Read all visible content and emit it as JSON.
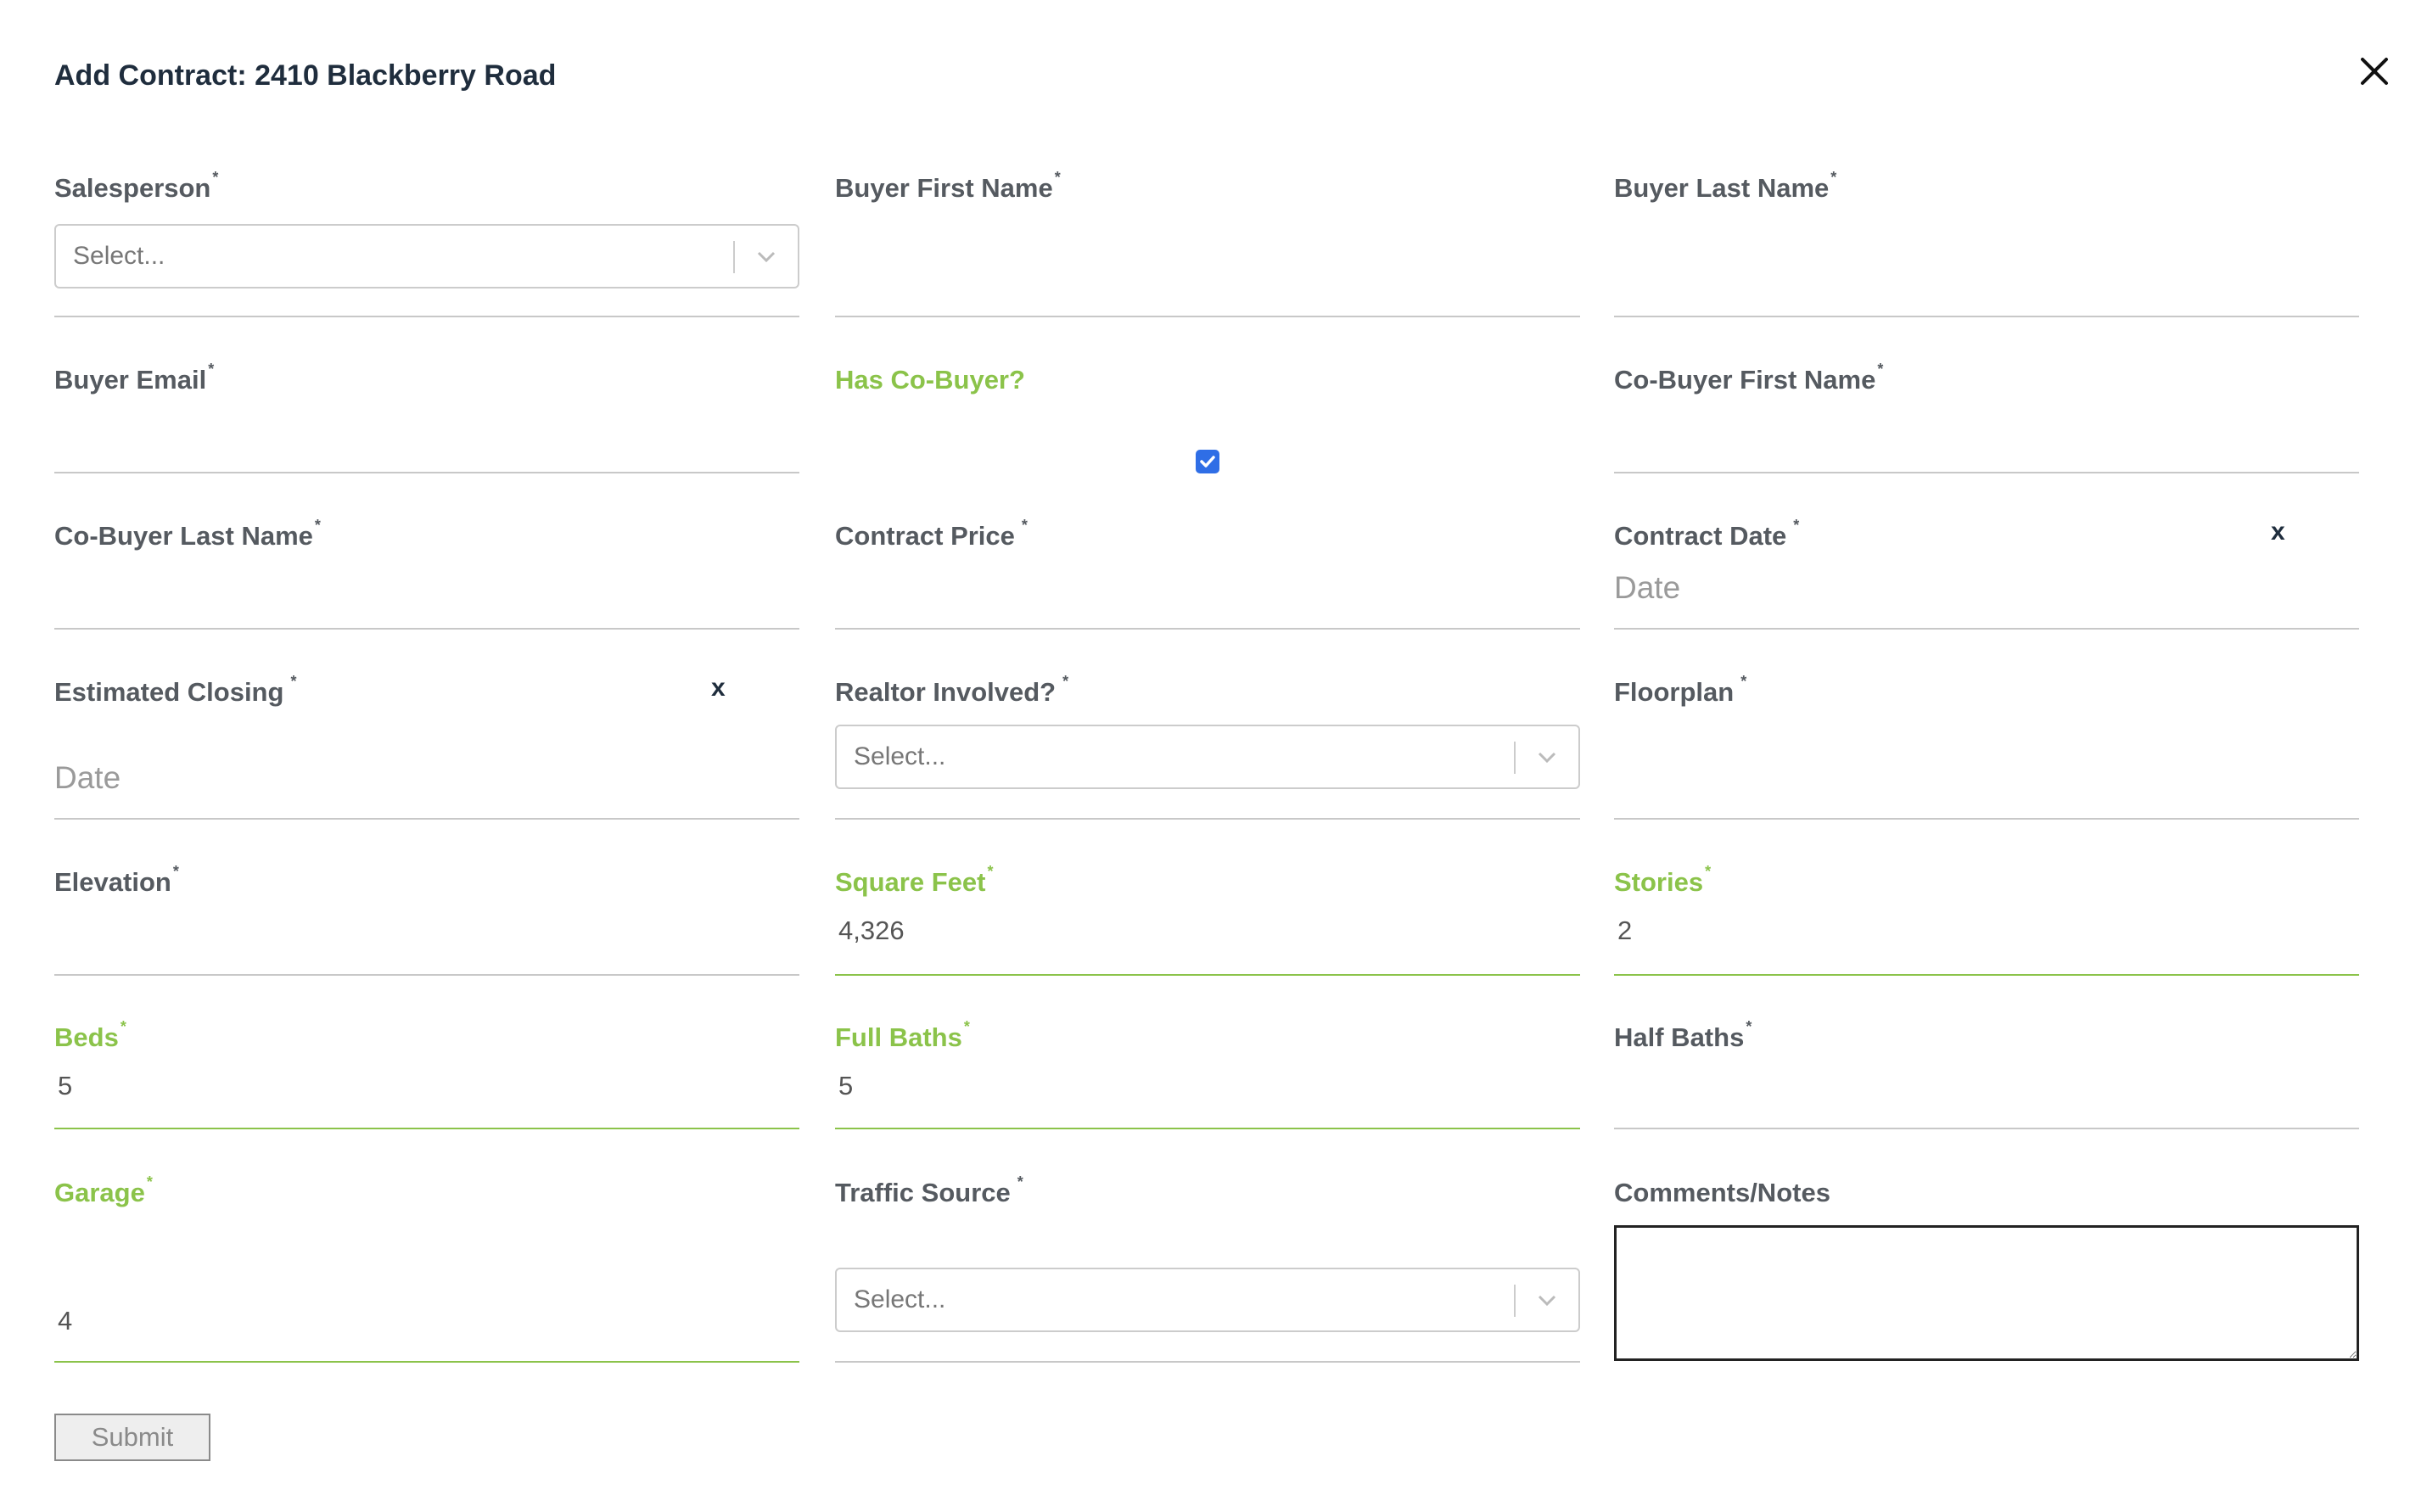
{
  "title": "Add Contract: 2410 Blackberry Road",
  "required_mark": "*",
  "fields": {
    "salesperson": {
      "label": "Salesperson",
      "placeholder": "Select..."
    },
    "buyer_first_name": {
      "label": "Buyer First Name",
      "value": ""
    },
    "buyer_last_name": {
      "label": "Buyer Last Name",
      "value": ""
    },
    "buyer_email": {
      "label": "Buyer Email",
      "value": ""
    },
    "has_co_buyer": {
      "label": "Has Co-Buyer?",
      "checked": true
    },
    "co_buyer_first_name": {
      "label": "Co-Buyer First Name",
      "value": ""
    },
    "co_buyer_last_name": {
      "label": "Co-Buyer Last Name",
      "value": ""
    },
    "contract_price": {
      "label": "Contract Price",
      "value": ""
    },
    "contract_date": {
      "label": "Contract Date",
      "placeholder": "Date",
      "clear": "x"
    },
    "estimated_closing": {
      "label": "Estimated Closing",
      "placeholder": "Date",
      "clear": "x"
    },
    "realtor_involved": {
      "label": "Realtor Involved?",
      "placeholder": "Select..."
    },
    "floorplan": {
      "label": "Floorplan",
      "value": ""
    },
    "elevation": {
      "label": "Elevation",
      "value": ""
    },
    "square_feet": {
      "label": "Square Feet",
      "value": "4,326"
    },
    "stories": {
      "label": "Stories",
      "value": "2"
    },
    "beds": {
      "label": "Beds",
      "value": "5"
    },
    "full_baths": {
      "label": "Full Baths",
      "value": "5"
    },
    "half_baths": {
      "label": "Half Baths",
      "value": ""
    },
    "garage": {
      "label": "Garage",
      "value": "4"
    },
    "traffic_source": {
      "label": "Traffic Source",
      "placeholder": "Select..."
    },
    "comments": {
      "label": "Comments/Notes",
      "value": ""
    }
  },
  "submit_label": "Submit",
  "colors": {
    "valid": "#8bc34a",
    "label": "#555a60",
    "title": "#1f2d3d",
    "checkbox": "#2f6ee6",
    "border": "#c8c8c8"
  },
  "icons": {
    "close": "close-icon",
    "dropdown": "chevron-down-icon",
    "check": "check-icon"
  }
}
